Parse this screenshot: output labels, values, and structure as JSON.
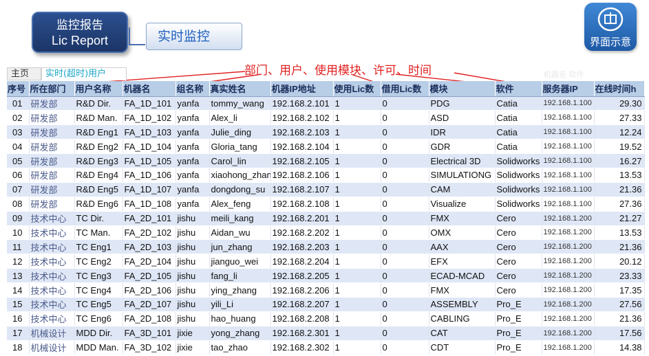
{
  "header": {
    "box_line1": "监控报告",
    "box_line2": "Lic Report",
    "section_title": "实时监控"
  },
  "icon_button": {
    "icon": "interface-icon",
    "caption": "界面示意"
  },
  "annotation": "部门、用户、使用模块、许可、时间",
  "tabs": [
    {
      "label": "主页"
    },
    {
      "label": "实时(超时)用户"
    }
  ],
  "ghost_text": "机器名 软件",
  "colors": {
    "header_bg": "#b8cde6",
    "row_alt": "#dfe7f6",
    "annotation": "#e02020",
    "accent": "#1f5fbf"
  },
  "table": {
    "columns": [
      "序号",
      "所在部门",
      "用户名称",
      "机器名",
      "组名称",
      "真实姓名",
      "机器IP地址",
      "使用Lic数",
      "借用Lic数",
      "模块",
      "软件",
      "服务器IP",
      "在线时间h"
    ],
    "rows": [
      [
        "01",
        "研发部",
        "R&D Dir.",
        "FA_1D_101",
        "yanfa",
        "tommy_wang",
        "192.168.2.101",
        "1",
        "0",
        "PDG",
        "Catia",
        "192.168.1.100",
        "29.30"
      ],
      [
        "02",
        "研发部",
        "R&D Man.",
        "FA_1D_102",
        "yanfa",
        "Alex_li",
        "192.168.2.102",
        "1",
        "0",
        "ASD",
        "Catia",
        "192.168.1.100",
        "27.33"
      ],
      [
        "03",
        "研发部",
        "R&D Eng1",
        "FA_1D_103",
        "yanfa",
        "Julie_ding",
        "192.168.2.103",
        "1",
        "0",
        "IDR",
        "Catia",
        "192.168.1.100",
        "12.24"
      ],
      [
        "04",
        "研发部",
        "R&D Eng2",
        "FA_1D_104",
        "yanfa",
        "Gloria_tang",
        "192.168.2.104",
        "1",
        "0",
        "GDR",
        "Catia",
        "192.168.1.100",
        "19.52"
      ],
      [
        "05",
        "研发部",
        "R&D Eng3",
        "FA_1D_105",
        "yanfa",
        "Carol_lin",
        "192.168.2.105",
        "1",
        "0",
        "Electrical 3D",
        "Solidworks",
        "192.168.1.100",
        "16.27"
      ],
      [
        "06",
        "研发部",
        "R&D Eng4",
        "FA_1D_106",
        "yanfa",
        "xiaohong_zhan",
        "192.168.2.106",
        "1",
        "0",
        "SIMULATIONG",
        "Solidworks",
        "192.168.1.100",
        "13.53"
      ],
      [
        "07",
        "研发部",
        "R&D Eng5",
        "FA_1D_107",
        "yanfa",
        "dongdong_su",
        "192.168.2.107",
        "1",
        "0",
        "CAM",
        "Solidworks",
        "192.168.1.100",
        "21.36"
      ],
      [
        "08",
        "研发部",
        "R&D Eng6",
        "FA_1D_108",
        "yanfa",
        "Alex_feng",
        "192.168.2.108",
        "1",
        "0",
        "Visualize",
        "Solidworks",
        "192.168.1.100",
        "27.36"
      ],
      [
        "09",
        "技术中心",
        "TC Dir.",
        "FA_2D_101",
        "jishu",
        "meili_kang",
        "192.168.2.201",
        "1",
        "0",
        "FMX",
        "Cero",
        "192.168.1.200",
        "21.27"
      ],
      [
        "10",
        "技术中心",
        "TC Man.",
        "FA_2D_102",
        "jishu",
        "Aidan_wu",
        "192.168.2.202",
        "1",
        "0",
        "OMX",
        "Cero",
        "192.168.1.200",
        "13.53"
      ],
      [
        "11",
        "技术中心",
        "TC Eng1",
        "FA_2D_103",
        "jishu",
        "jun_zhang",
        "192.168.2.203",
        "1",
        "0",
        "AAX",
        "Cero",
        "192.168.1.200",
        "21.36"
      ],
      [
        "12",
        "技术中心",
        "TC Eng2",
        "FA_2D_104",
        "jishu",
        "jianguo_wei",
        "192.168.2.204",
        "1",
        "0",
        "EFX",
        "Cero",
        "192.168.1.200",
        "20.12"
      ],
      [
        "13",
        "技术中心",
        "TC Eng3",
        "FA_2D_105",
        "jishu",
        "fang_li",
        "192.168.2.205",
        "1",
        "0",
        "ECAD-MCAD",
        "Cero",
        "192.168.1.200",
        "23.33"
      ],
      [
        "14",
        "技术中心",
        "TC Eng4",
        "FA_2D_106",
        "jishu",
        "ying_zhang",
        "192.168.2.206",
        "1",
        "0",
        "FMX",
        "Cero",
        "192.168.1.200",
        "17.35"
      ],
      [
        "15",
        "技术中心",
        "TC Eng5",
        "FA_2D_107",
        "jishu",
        "yili_Li",
        "192.168.2.207",
        "1",
        "0",
        "ASSEMBLY",
        "Pro_E",
        "192.168.1.200",
        "27.56"
      ],
      [
        "16",
        "技术中心",
        "TC Eng6",
        "FA_2D_108",
        "jishu",
        "hao_huang",
        "192.168.2.208",
        "1",
        "0",
        "CABLING",
        "Pro_E",
        "192.168.1.200",
        "21.36"
      ],
      [
        "17",
        "机械设计",
        "MDD Dir.",
        "FA_3D_101",
        "jixie",
        "yong_zhang",
        "192.168.2.301",
        "1",
        "0",
        "CAT",
        "Pro_E",
        "192.168.1.200",
        "17.56"
      ],
      [
        "18",
        "机械设计",
        "MDD Man.",
        "FA_3D_102",
        "jixie",
        "tao_zhao",
        "192.168.2.302",
        "1",
        "0",
        "CDT",
        "Pro_E",
        "192.168.1.200",
        "14.38"
      ]
    ]
  }
}
